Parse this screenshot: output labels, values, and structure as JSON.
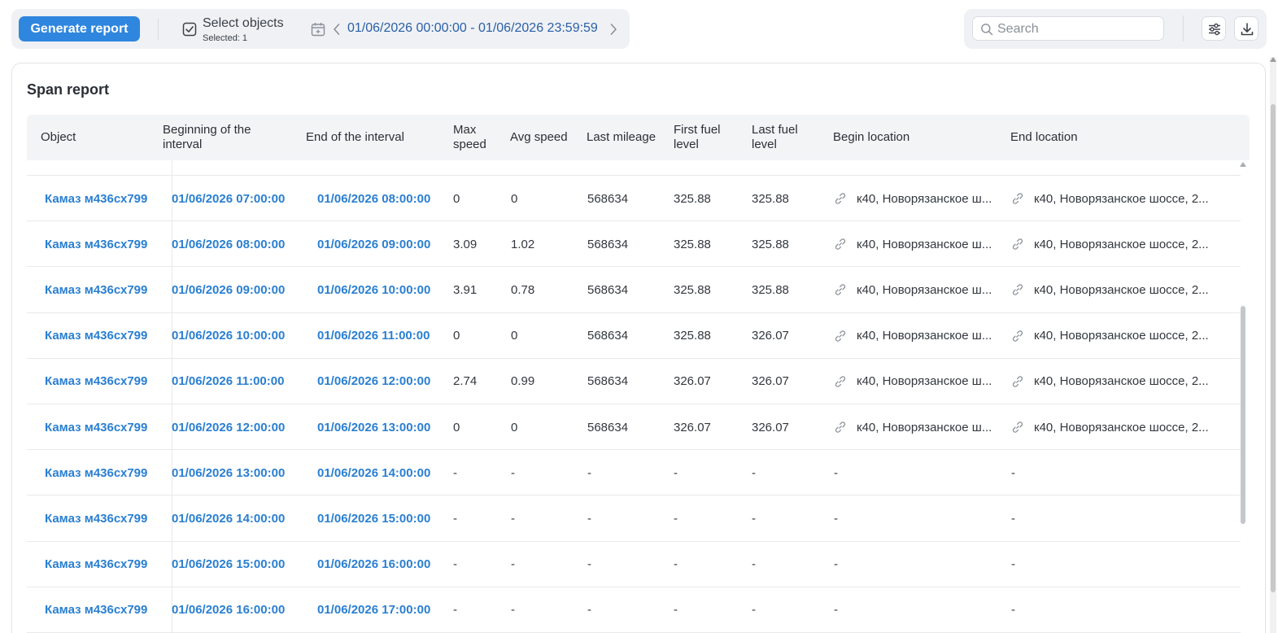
{
  "toolbar": {
    "generate_label": "Generate report",
    "select_title": "Select objects",
    "select_subtitle": "Selected: 1",
    "date_range": "01/06/2026 00:00:00 - 01/06/2026 23:59:59"
  },
  "search": {
    "placeholder": "Search",
    "value": ""
  },
  "report": {
    "title": "Span report",
    "columns": [
      "Object",
      "Beginning of the interval",
      "End of the interval",
      "Max speed",
      "Avg speed",
      "Last mileage",
      "First fuel level",
      "Last fuel level",
      "Begin location",
      "End location"
    ],
    "rows": [
      {
        "object": "Камаз м436сх799",
        "begin": "01/06/2026 07:00:00",
        "end": "01/06/2026 08:00:00",
        "max_speed": "0",
        "avg_speed": "0",
        "mileage": "568634",
        "fuel_first": "325.88",
        "fuel_last": "325.88",
        "begin_loc": "к40, Новорязанское ш...",
        "end_loc": "к40, Новорязанское шоссе, 2..."
      },
      {
        "object": "Камаз м436сх799",
        "begin": "01/06/2026 08:00:00",
        "end": "01/06/2026 09:00:00",
        "max_speed": "3.09",
        "avg_speed": "1.02",
        "mileage": "568634",
        "fuel_first": "325.88",
        "fuel_last": "325.88",
        "begin_loc": "к40, Новорязанское ш...",
        "end_loc": "к40, Новорязанское шоссе, 2..."
      },
      {
        "object": "Камаз м436сх799",
        "begin": "01/06/2026 09:00:00",
        "end": "01/06/2026 10:00:00",
        "max_speed": "3.91",
        "avg_speed": "0.78",
        "mileage": "568634",
        "fuel_first": "325.88",
        "fuel_last": "325.88",
        "begin_loc": "к40, Новорязанское ш...",
        "end_loc": "к40, Новорязанское шоссе, 2..."
      },
      {
        "object": "Камаз м436сх799",
        "begin": "01/06/2026 10:00:00",
        "end": "01/06/2026 11:00:00",
        "max_speed": "0",
        "avg_speed": "0",
        "mileage": "568634",
        "fuel_first": "325.88",
        "fuel_last": "326.07",
        "begin_loc": "к40, Новорязанское ш...",
        "end_loc": "к40, Новорязанское шоссе, 2..."
      },
      {
        "object": "Камаз м436сх799",
        "begin": "01/06/2026 11:00:00",
        "end": "01/06/2026 12:00:00",
        "max_speed": "2.74",
        "avg_speed": "0.99",
        "mileage": "568634",
        "fuel_first": "326.07",
        "fuel_last": "326.07",
        "begin_loc": "к40, Новорязанское ш...",
        "end_loc": "к40, Новорязанское шоссе, 2..."
      },
      {
        "object": "Камаз м436сх799",
        "begin": "01/06/2026 12:00:00",
        "end": "01/06/2026 13:00:00",
        "max_speed": "0",
        "avg_speed": "0",
        "mileage": "568634",
        "fuel_first": "326.07",
        "fuel_last": "326.07",
        "begin_loc": "к40, Новорязанское ш...",
        "end_loc": "к40, Новорязанское шоссе, 2..."
      },
      {
        "object": "Камаз м436сх799",
        "begin": "01/06/2026 13:00:00",
        "end": "01/06/2026 14:00:00",
        "max_speed": "-",
        "avg_speed": "-",
        "mileage": "-",
        "fuel_first": "-",
        "fuel_last": "-",
        "begin_loc": "-",
        "end_loc": "-"
      },
      {
        "object": "Камаз м436сх799",
        "begin": "01/06/2026 14:00:00",
        "end": "01/06/2026 15:00:00",
        "max_speed": "-",
        "avg_speed": "-",
        "mileage": "-",
        "fuel_first": "-",
        "fuel_last": "-",
        "begin_loc": "-",
        "end_loc": "-"
      },
      {
        "object": "Камаз м436сх799",
        "begin": "01/06/2026 15:00:00",
        "end": "01/06/2026 16:00:00",
        "max_speed": "-",
        "avg_speed": "-",
        "mileage": "-",
        "fuel_first": "-",
        "fuel_last": "-",
        "begin_loc": "-",
        "end_loc": "-"
      },
      {
        "object": "Камаз м436сх799",
        "begin": "01/06/2026 16:00:00",
        "end": "01/06/2026 17:00:00",
        "max_speed": "-",
        "avg_speed": "-",
        "mileage": "-",
        "fuel_first": "-",
        "fuel_last": "-",
        "begin_loc": "-",
        "end_loc": "-"
      }
    ]
  },
  "icons": {
    "select": "checkbox-icon",
    "calendar": "calendar-icon",
    "prev": "chevron-left-icon",
    "next": "chevron-right-icon",
    "search": "search-icon",
    "settings": "sliders-icon",
    "download": "download-icon",
    "location": "link-icon"
  },
  "colors": {
    "accent": "#2f86de",
    "link": "#2a7fd1",
    "date_text": "#2a5fa8"
  }
}
